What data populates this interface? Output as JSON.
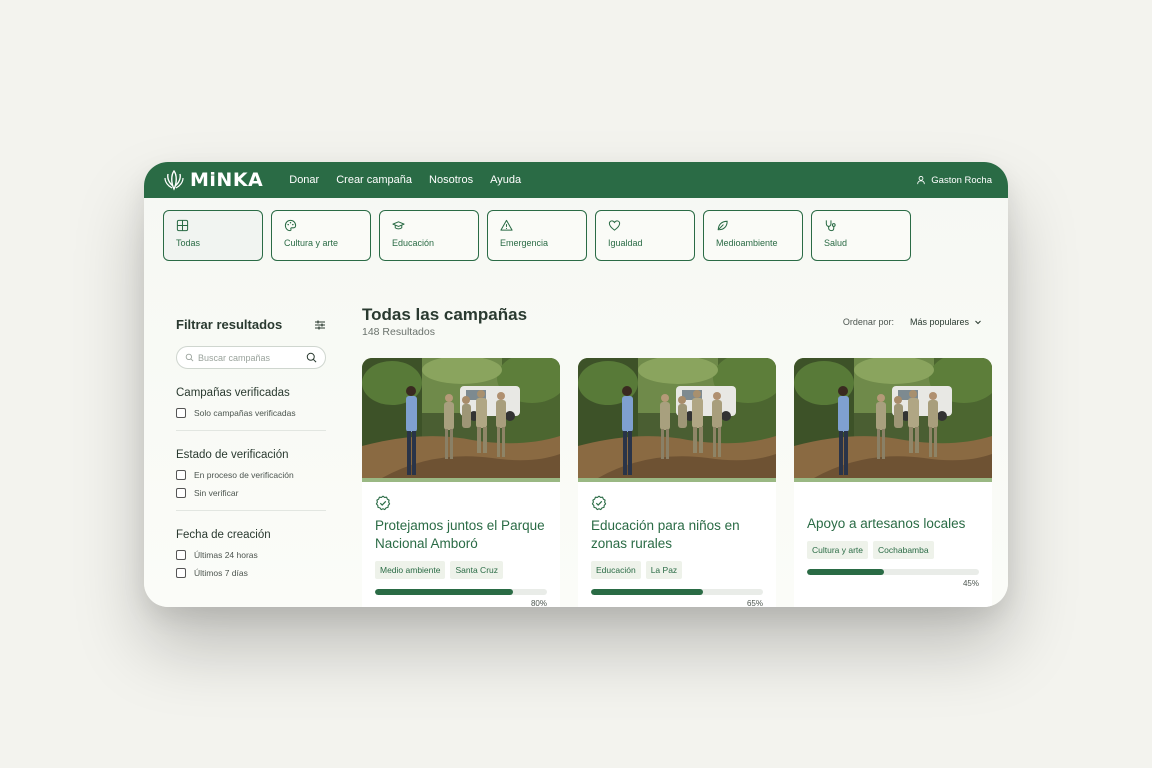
{
  "brand": {
    "name": "MiNKA"
  },
  "nav": {
    "links": [
      "Donar",
      "Crear campaña",
      "Nosotros",
      "Ayuda"
    ],
    "user": "Gaston Rocha"
  },
  "categories": [
    {
      "label": "Todas",
      "icon": "grid-icon",
      "active": true
    },
    {
      "label": "Cultura y arte",
      "icon": "palette-icon"
    },
    {
      "label": "Educación",
      "icon": "graduation-cap-icon"
    },
    {
      "label": "Emergencia",
      "icon": "warning-icon"
    },
    {
      "label": "Igualdad",
      "icon": "heart-icon"
    },
    {
      "label": "Medioambiente",
      "icon": "leaf-icon"
    },
    {
      "label": "Salud",
      "icon": "stethoscope-icon"
    }
  ],
  "sidebar": {
    "title": "Filtrar resultados",
    "search_placeholder": "Buscar campañas",
    "sections": [
      {
        "title": "Campañas verificadas",
        "options": [
          "Solo campañas verificadas"
        ]
      },
      {
        "title": "Estado de verificación",
        "options": [
          "En proceso de verificación",
          "Sin verificar"
        ]
      },
      {
        "title": "Fecha de creación",
        "options": [
          "Últimas 24 horas",
          "Últimos 7 días"
        ]
      }
    ]
  },
  "main": {
    "title": "Todas las campañas",
    "results": "148 Resultados",
    "sort_label": "Ordenar por:",
    "sort_value": "Más populares"
  },
  "campaigns": [
    {
      "title": "Protejamos juntos el Parque Nacional Amboró",
      "verified": true,
      "tags": [
        "Medio ambiente",
        "Santa Cruz"
      ],
      "progress": 80,
      "progress_label": "80%"
    },
    {
      "title": "Educación para niños en zonas rurales",
      "verified": true,
      "tags": [
        "Educación",
        "La Paz"
      ],
      "progress": 65,
      "progress_label": "65%"
    },
    {
      "title": "Apoyo a artesanos locales",
      "verified": false,
      "tags": [
        "Cultura y arte",
        "Cochabamba"
      ],
      "progress": 45,
      "progress_label": "45%"
    }
  ],
  "colors": {
    "brand": "#2a6b45",
    "tag_bg": "#eef2ea",
    "progress_track": "#e9ece8"
  }
}
